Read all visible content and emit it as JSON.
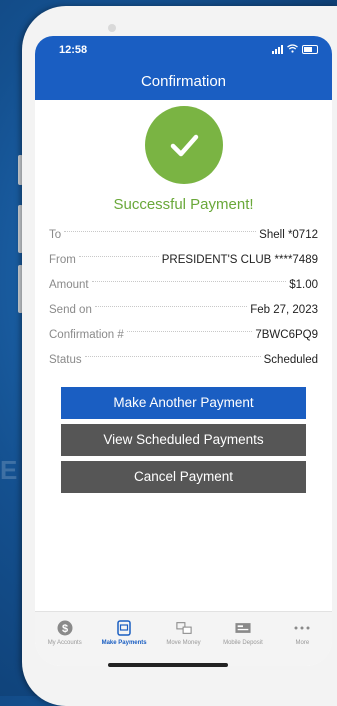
{
  "status_bar": {
    "time": "12:58"
  },
  "header": {
    "title": "Confirmation"
  },
  "result": {
    "message": "Successful Payment!"
  },
  "details": [
    {
      "label": "To",
      "value": "Shell *0712"
    },
    {
      "label": "From",
      "value": "PRESIDENT'S CLUB ****7489"
    },
    {
      "label": "Amount",
      "value": "$1.00"
    },
    {
      "label": "Send on",
      "value": "Feb 27, 2023"
    },
    {
      "label": "Confirmation #",
      "value": "7BWC6PQ9"
    },
    {
      "label": "Status",
      "value": "Scheduled"
    }
  ],
  "actions": {
    "make_another": "Make Another Payment",
    "view_scheduled": "View Scheduled Payments",
    "cancel": "Cancel Payment"
  },
  "tabs": [
    {
      "label": "My Accounts",
      "icon": "dollar-circle-icon"
    },
    {
      "label": "Make Payments",
      "icon": "payments-icon",
      "active": true
    },
    {
      "label": "Move Money",
      "icon": "transfer-icon"
    },
    {
      "label": "Mobile Deposit",
      "icon": "check-deposit-icon"
    },
    {
      "label": "More",
      "icon": "more-dots-icon"
    }
  ],
  "colors": {
    "brand": "#1a5ec2",
    "success": "#7ab443",
    "secondary_button": "#565656"
  }
}
